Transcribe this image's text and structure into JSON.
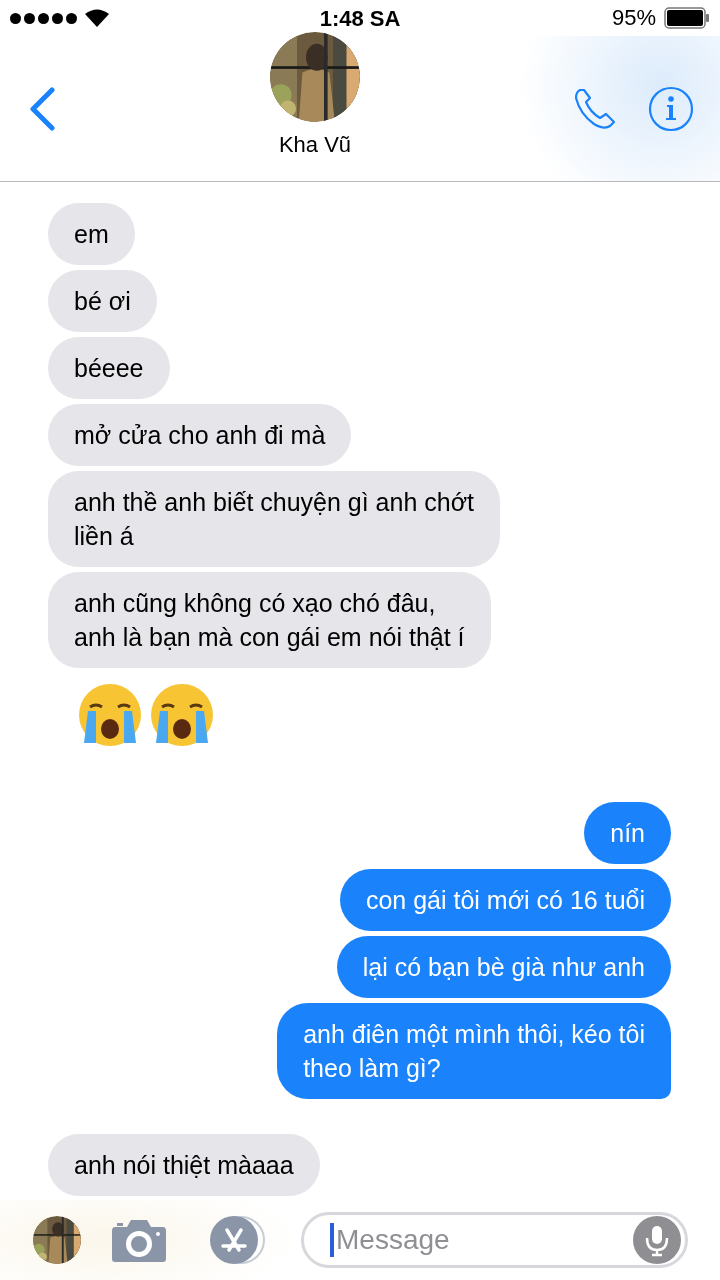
{
  "status_bar": {
    "time": "1:48 SA",
    "battery": "95%"
  },
  "header": {
    "contact_name": "Kha Vũ"
  },
  "messages": [
    {
      "outgoing": false,
      "kind": "text",
      "text": "em",
      "tail": false
    },
    {
      "outgoing": false,
      "kind": "text",
      "text": "bé ơi",
      "tail": false
    },
    {
      "outgoing": false,
      "kind": "text",
      "text": "béeee",
      "tail": false
    },
    {
      "outgoing": false,
      "kind": "text",
      "text": "mở cửa cho anh đi mà",
      "tail": false
    },
    {
      "outgoing": false,
      "kind": "text",
      "text": "anh thề anh biết chuyện gì anh chớt\nliền á",
      "tail": false
    },
    {
      "outgoing": false,
      "kind": "text",
      "text": "anh cũng không có xạo chó đâu,\nanh là bạn mà con gái em nói thật í",
      "tail": false
    },
    {
      "kind": "crying-emoji"
    },
    {
      "kind": "crying-emoji"
    },
    {
      "outgoing": true,
      "kind": "text",
      "text": "nín",
      "tail": false
    },
    {
      "outgoing": true,
      "kind": "text",
      "text": "con gái tôi mới có 16 tuổi",
      "tail": false
    },
    {
      "outgoing": true,
      "kind": "text",
      "text": "lại có bạn bè già như anh",
      "tail": false
    },
    {
      "outgoing": true,
      "kind": "text",
      "text": "anh điên một mình thôi, kéo tôi\ntheo làm gì?",
      "tail": true
    },
    {
      "outgoing": false,
      "kind": "text",
      "text": "anh nói thiệt màaaa",
      "tail": false
    }
  ],
  "compose": {
    "placeholder": "Message"
  }
}
